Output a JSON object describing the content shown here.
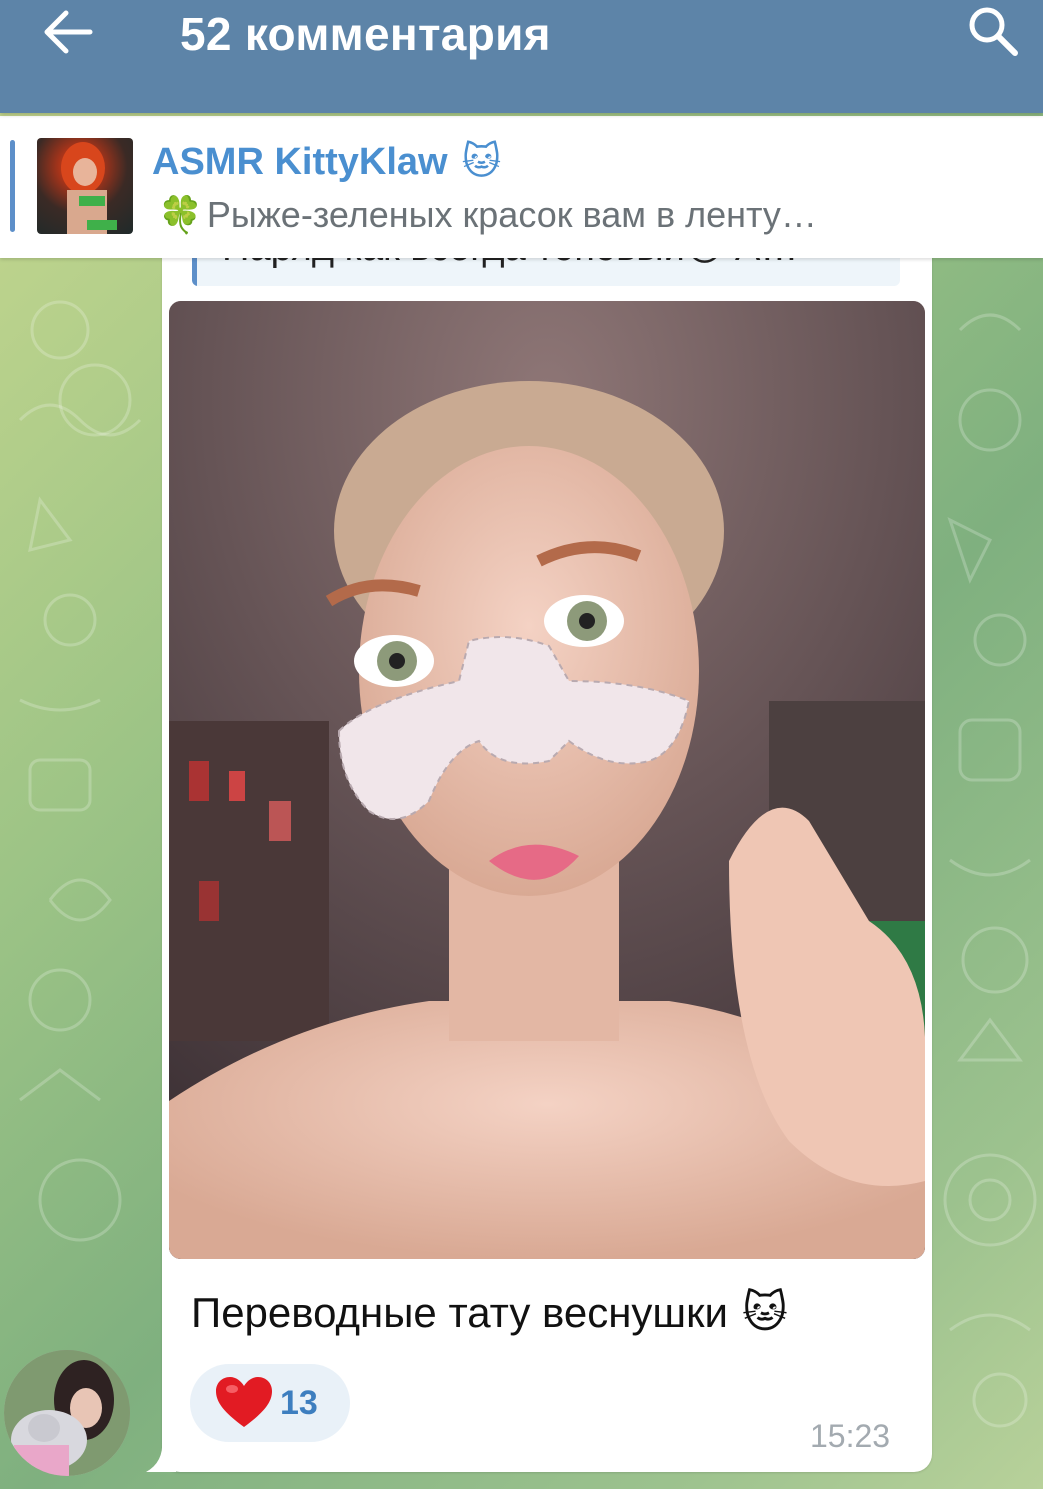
{
  "header": {
    "title": "52 комментария",
    "back_icon": "arrow-left-icon",
    "search_icon": "search-icon",
    "background": "#5d84a8"
  },
  "pinned": {
    "name": "ASMR KittyKlaw",
    "name_emoji": "🐱",
    "text_emoji": "🍀",
    "text": "Рыже-зеленых красок вам в ленту…",
    "accent": "#4a8fd0"
  },
  "message": {
    "reply_preview": "Наряд как всегда топовый😊 А…",
    "caption": "Переводные тату веснушки",
    "caption_emoji": "🐱",
    "reaction": {
      "emoji": "❤",
      "count": "13"
    },
    "time": "15:23"
  }
}
